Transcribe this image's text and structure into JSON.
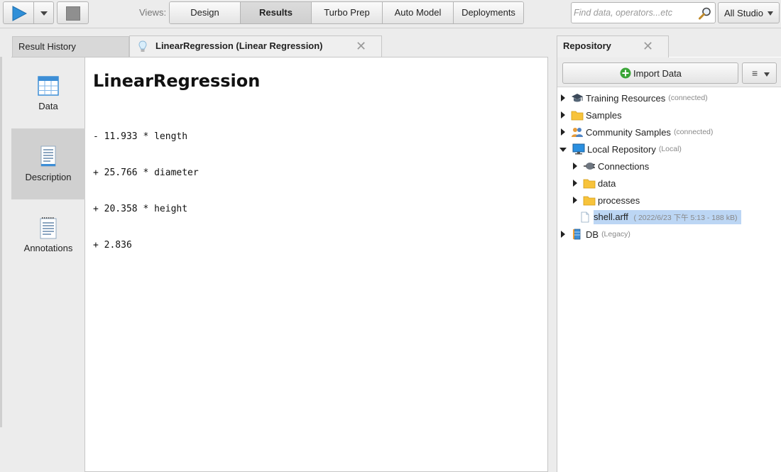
{
  "toolbar": {
    "views_label": "Views:",
    "views": [
      {
        "label": "Design",
        "active": false
      },
      {
        "label": "Results",
        "active": true
      },
      {
        "label": "Turbo Prep",
        "active": false
      },
      {
        "label": "Auto Model",
        "active": false
      },
      {
        "label": "Deployments",
        "active": false
      }
    ],
    "search_placeholder": "Find data, operators...etc",
    "scope_label": "All Studio",
    "icons": {
      "run": "play-icon",
      "run_menu": "chevron-down-icon",
      "stop": "stop-icon",
      "search": "magnifier-icon"
    }
  },
  "results": {
    "history_tab": "Result History",
    "active_tab": "LinearRegression (Linear Regression)",
    "sidebar": [
      {
        "label": "Data",
        "icon": "table-icon",
        "active": false
      },
      {
        "label": "Description",
        "icon": "document-icon",
        "active": true
      },
      {
        "label": "Annotations",
        "icon": "notes-icon",
        "active": false
      }
    ],
    "title": "LinearRegression",
    "formula": [
      "- 11.933 * length",
      "+ 25.766 * diameter",
      "+ 20.358 * height",
      "+ 2.836"
    ]
  },
  "repository": {
    "tab": "Repository",
    "import_label": "Import Data",
    "tree": [
      {
        "label": "Training Resources",
        "sub": "(connected)",
        "icon": "graduation-cap-icon",
        "state": "closed",
        "level": 0
      },
      {
        "label": "Samples",
        "sub": "",
        "icon": "folder-icon",
        "state": "closed",
        "level": 0
      },
      {
        "label": "Community Samples",
        "sub": "(connected)",
        "icon": "people-icon",
        "state": "closed",
        "level": 0
      },
      {
        "label": "Local Repository",
        "sub": "(Local)",
        "icon": "monitor-icon",
        "state": "open",
        "level": 0
      },
      {
        "label": "Connections",
        "sub": "",
        "icon": "plug-icon",
        "state": "closed",
        "level": 1
      },
      {
        "label": "data",
        "sub": "",
        "icon": "folder-icon",
        "state": "closed",
        "level": 1
      },
      {
        "label": "processes",
        "sub": "",
        "icon": "folder-icon",
        "state": "closed",
        "level": 1
      },
      {
        "label": "shell.arff",
        "sub": "( 2022/6/23 下午 5:13 - 188 kB)",
        "icon": "file-icon",
        "state": "none",
        "level": 1,
        "selected": true
      },
      {
        "label": "DB",
        "sub": "(Legacy)",
        "icon": "database-icon",
        "state": "closed",
        "level": 0
      }
    ]
  }
}
